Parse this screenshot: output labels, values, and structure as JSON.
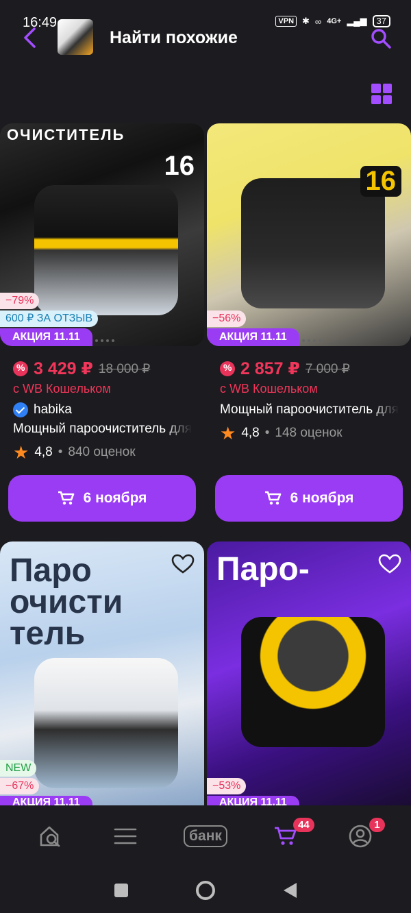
{
  "status_bar": {
    "time": "16:49",
    "vpn": "VPN",
    "network": "4G+",
    "battery": "37"
  },
  "header": {
    "title": "Найти похожие"
  },
  "products": [
    {
      "image_caption": "ОЧИСТИТЕЛЬ",
      "image_number": "16",
      "discount": "−79%",
      "review_bonus": "600 ₽ ЗА ОТЗЫВ",
      "promo": "АКЦИЯ 11.11",
      "price": "3 429 ₽",
      "old_price": "18 000 ₽",
      "wallet": "с WB Кошельком",
      "brand": "habika",
      "name": "Мощный пароочиститель для дома",
      "rating": "4,8",
      "reviews": "840 оценок",
      "delivery": "6 ноября"
    },
    {
      "image_number": "16",
      "discount": "−56%",
      "promo": "АКЦИЯ 11.11",
      "price": "2 857 ₽",
      "old_price": "7 000 ₽",
      "wallet": "с WB Кошельком",
      "name": "Мощный пароочиститель для дома",
      "rating": "4,8",
      "reviews": "148 оценок",
      "delivery": "6 ноября"
    },
    {
      "image_caption": "Паро очисти тель",
      "new_label": "NEW",
      "discount": "−67%",
      "promo": "АКЦИЯ 11.11"
    },
    {
      "image_caption": "Паро-",
      "discount": "−53%",
      "promo": "АКЦИЯ 11.11"
    }
  ],
  "bottom_nav": {
    "bank_label": "банк",
    "cart_count": "44",
    "profile_count": "1"
  },
  "colors": {
    "accent": "#9b3cf5",
    "price": "#f0365a",
    "star": "#ff8a1f",
    "background": "#1c1b1f"
  }
}
